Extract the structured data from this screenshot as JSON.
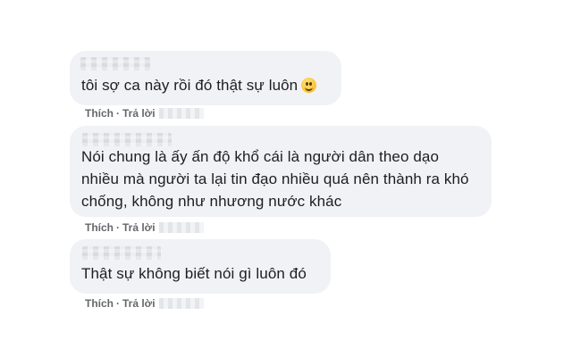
{
  "comments": [
    {
      "author": "",
      "lines": [
        "tôi sợ ca này rồi đó thật sự luôn"
      ],
      "emoji": "smiling-face-icon",
      "actions": {
        "like": "Thích",
        "separator": "·",
        "reply": "Trả lời"
      }
    },
    {
      "author": "",
      "lines": [
        "Nói chung là ấy ấn độ khổ cái là người dân theo dạo",
        "nhiều mà người ta lại tin đạo nhiều quá nên thành ra khó",
        "chống, không như nhương nước khác"
      ],
      "actions": {
        "like": "Thích",
        "separator": "·",
        "reply": "Trả lời"
      }
    },
    {
      "author": "",
      "lines": [
        "Thật sự không biết nói gì luôn đó"
      ],
      "actions": {
        "like": "Thích",
        "separator": "·",
        "reply": "Trả lời"
      }
    }
  ],
  "colors": {
    "bubble": "#f0f2f5",
    "text": "#1c1e21",
    "actions": "#65676b",
    "background": "#ffffff"
  }
}
